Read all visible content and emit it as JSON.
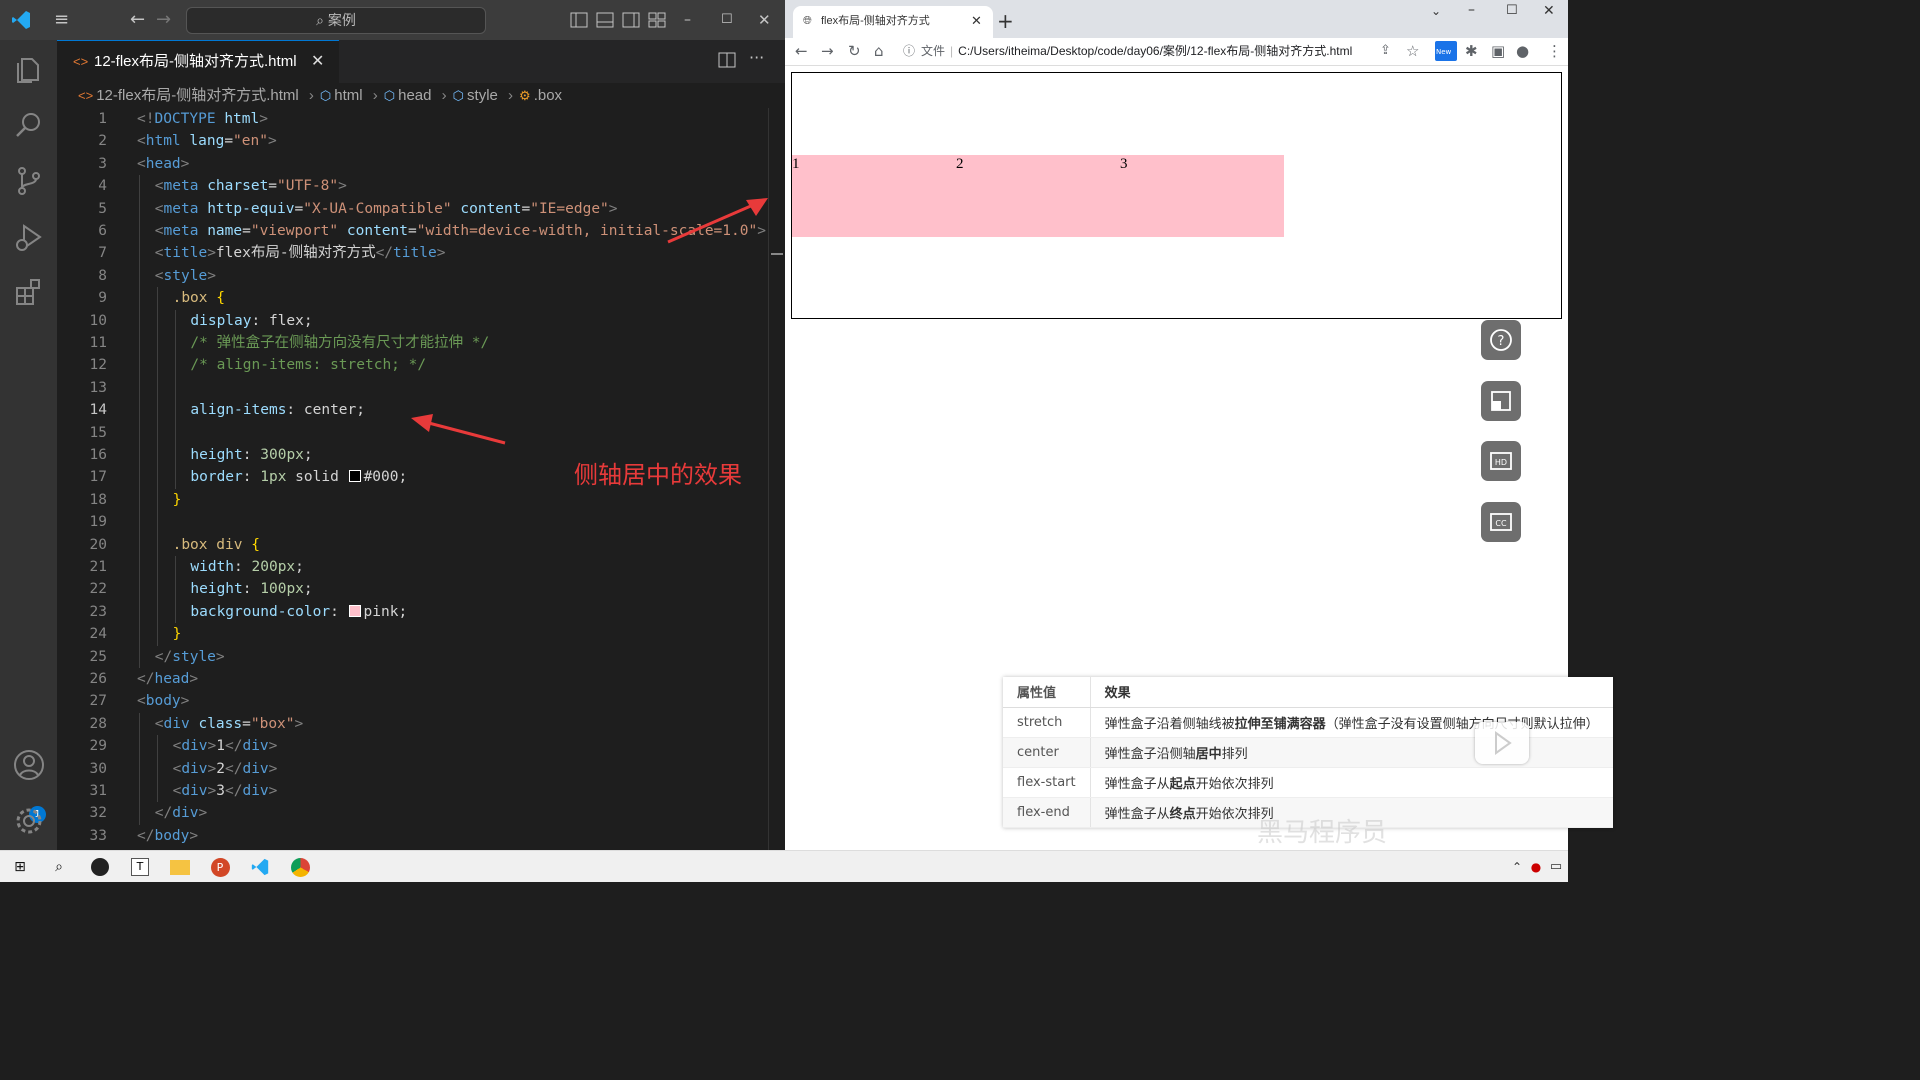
{
  "vscode": {
    "search_placeholder": "案例",
    "tab": {
      "label": "12-flex布局-侧轴对齐方式.html",
      "icon": "html-file-icon"
    },
    "breadcrumb": [
      "12-flex布局-侧轴对齐方式.html",
      "html",
      "head",
      "style",
      ".box"
    ],
    "active_line": 14,
    "account_badge": "1",
    "annotation": "侧轴居中的效果"
  },
  "code": [
    {
      "n": "1",
      "indent": 0,
      "parts": [
        [
          "t-br",
          "<!"
        ],
        [
          "t-tag",
          "DOCTYPE"
        ],
        [
          "t-txt",
          " "
        ],
        [
          "t-attr",
          "html"
        ],
        [
          "t-br",
          ">"
        ]
      ]
    },
    {
      "n": "2",
      "indent": 0,
      "parts": [
        [
          "t-br",
          "<"
        ],
        [
          "t-tag",
          "html"
        ],
        [
          "t-txt",
          " "
        ],
        [
          "t-attr",
          "lang"
        ],
        [
          "t-txt",
          "="
        ],
        [
          "t-str",
          "\"en\""
        ],
        [
          "t-br",
          ">"
        ]
      ]
    },
    {
      "n": "3",
      "indent": 0,
      "parts": [
        [
          "t-br",
          "<"
        ],
        [
          "t-tag",
          "head"
        ],
        [
          "t-br",
          ">"
        ]
      ]
    },
    {
      "n": "4",
      "indent": 1,
      "parts": [
        [
          "t-br",
          "<"
        ],
        [
          "t-tag",
          "meta"
        ],
        [
          "t-txt",
          " "
        ],
        [
          "t-attr",
          "charset"
        ],
        [
          "t-txt",
          "="
        ],
        [
          "t-str",
          "\"UTF-8\""
        ],
        [
          "t-br",
          ">"
        ]
      ]
    },
    {
      "n": "5",
      "indent": 1,
      "parts": [
        [
          "t-br",
          "<"
        ],
        [
          "t-tag",
          "meta"
        ],
        [
          "t-txt",
          " "
        ],
        [
          "t-attr",
          "http-equiv"
        ],
        [
          "t-txt",
          "="
        ],
        [
          "t-str",
          "\"X-UA-Compatible\""
        ],
        [
          "t-txt",
          " "
        ],
        [
          "t-attr",
          "content"
        ],
        [
          "t-txt",
          "="
        ],
        [
          "t-str",
          "\"IE=edge\""
        ],
        [
          "t-br",
          ">"
        ]
      ]
    },
    {
      "n": "6",
      "indent": 1,
      "parts": [
        [
          "t-br",
          "<"
        ],
        [
          "t-tag",
          "meta"
        ],
        [
          "t-txt",
          " "
        ],
        [
          "t-attr",
          "name"
        ],
        [
          "t-txt",
          "="
        ],
        [
          "t-str",
          "\"viewport\""
        ],
        [
          "t-txt",
          " "
        ],
        [
          "t-attr",
          "content"
        ],
        [
          "t-txt",
          "="
        ],
        [
          "t-str",
          "\"width=device-width, initial-scale=1.0\""
        ],
        [
          "t-br",
          ">"
        ]
      ]
    },
    {
      "n": "7",
      "indent": 1,
      "parts": [
        [
          "t-br",
          "<"
        ],
        [
          "t-tag",
          "title"
        ],
        [
          "t-br",
          ">"
        ],
        [
          "t-txt",
          "flex布局-侧轴对齐方式"
        ],
        [
          "t-br",
          "</"
        ],
        [
          "t-tag",
          "title"
        ],
        [
          "t-br",
          ">"
        ]
      ]
    },
    {
      "n": "8",
      "indent": 1,
      "parts": [
        [
          "t-br",
          "<"
        ],
        [
          "t-tag",
          "style"
        ],
        [
          "t-br",
          ">"
        ]
      ]
    },
    {
      "n": "9",
      "indent": 2,
      "parts": [
        [
          "t-sel",
          ".box"
        ],
        [
          "t-txt",
          " "
        ],
        [
          "t-brace",
          "{"
        ]
      ]
    },
    {
      "n": "10",
      "indent": 3,
      "parts": [
        [
          "t-prop",
          "display"
        ],
        [
          "t-txt",
          ": "
        ],
        [
          "t-txt",
          "flex"
        ],
        [
          "t-txt",
          ";"
        ]
      ]
    },
    {
      "n": "11",
      "indent": 3,
      "parts": [
        [
          "t-cm",
          "/* 弹性盒子在侧轴方向没有尺寸才能拉伸 */"
        ]
      ]
    },
    {
      "n": "12",
      "indent": 3,
      "parts": [
        [
          "t-cm",
          "/* align-items: stretch; */"
        ]
      ]
    },
    {
      "n": "13",
      "indent": 3,
      "parts": []
    },
    {
      "n": "14",
      "indent": 3,
      "parts": [
        [
          "t-prop",
          "align-items"
        ],
        [
          "t-txt",
          ": "
        ],
        [
          "t-txt",
          "center"
        ],
        [
          "t-txt",
          ";"
        ]
      ]
    },
    {
      "n": "15",
      "indent": 3,
      "parts": []
    },
    {
      "n": "16",
      "indent": 3,
      "parts": [
        [
          "t-prop",
          "height"
        ],
        [
          "t-txt",
          ": "
        ],
        [
          "t-num",
          "300px"
        ],
        [
          "t-txt",
          ";"
        ]
      ]
    },
    {
      "n": "17",
      "indent": 3,
      "parts": [
        [
          "t-prop",
          "border"
        ],
        [
          "t-txt",
          ": "
        ],
        [
          "t-num",
          "1px"
        ],
        [
          "t-txt",
          " solid "
        ],
        [
          "swatch",
          "#000"
        ],
        [
          "t-txt",
          "#000;"
        ]
      ]
    },
    {
      "n": "18",
      "indent": 2,
      "parts": [
        [
          "t-brace",
          "}"
        ]
      ]
    },
    {
      "n": "19",
      "indent": 2,
      "parts": []
    },
    {
      "n": "20",
      "indent": 2,
      "parts": [
        [
          "t-sel",
          ".box"
        ],
        [
          "t-txt",
          " "
        ],
        [
          "t-sel",
          "div"
        ],
        [
          "t-txt",
          " "
        ],
        [
          "t-brace",
          "{"
        ]
      ]
    },
    {
      "n": "21",
      "indent": 3,
      "parts": [
        [
          "t-prop",
          "width"
        ],
        [
          "t-txt",
          ": "
        ],
        [
          "t-num",
          "200px"
        ],
        [
          "t-txt",
          ";"
        ]
      ]
    },
    {
      "n": "22",
      "indent": 3,
      "parts": [
        [
          "t-prop",
          "height"
        ],
        [
          "t-txt",
          ": "
        ],
        [
          "t-num",
          "100px"
        ],
        [
          "t-txt",
          ";"
        ]
      ]
    },
    {
      "n": "23",
      "indent": 3,
      "parts": [
        [
          "t-prop",
          "background-color"
        ],
        [
          "t-txt",
          ": "
        ],
        [
          "swatch",
          "pink"
        ],
        [
          "t-txt",
          "pink;"
        ]
      ]
    },
    {
      "n": "24",
      "indent": 2,
      "parts": [
        [
          "t-brace",
          "}"
        ]
      ]
    },
    {
      "n": "25",
      "indent": 1,
      "parts": [
        [
          "t-br",
          "</"
        ],
        [
          "t-tag",
          "style"
        ],
        [
          "t-br",
          ">"
        ]
      ]
    },
    {
      "n": "26",
      "indent": 0,
      "parts": [
        [
          "t-br",
          "</"
        ],
        [
          "t-tag",
          "head"
        ],
        [
          "t-br",
          ">"
        ]
      ]
    },
    {
      "n": "27",
      "indent": 0,
      "parts": [
        [
          "t-br",
          "<"
        ],
        [
          "t-tag",
          "body"
        ],
        [
          "t-br",
          ">"
        ]
      ]
    },
    {
      "n": "28",
      "indent": 1,
      "parts": [
        [
          "t-br",
          "<"
        ],
        [
          "t-tag",
          "div"
        ],
        [
          "t-txt",
          " "
        ],
        [
          "t-attr",
          "class"
        ],
        [
          "t-txt",
          "="
        ],
        [
          "t-str",
          "\"box\""
        ],
        [
          "t-br",
          ">"
        ]
      ]
    },
    {
      "n": "29",
      "indent": 2,
      "parts": [
        [
          "t-br",
          "<"
        ],
        [
          "t-tag",
          "div"
        ],
        [
          "t-br",
          ">"
        ],
        [
          "t-txt",
          "1"
        ],
        [
          "t-br",
          "</"
        ],
        [
          "t-tag",
          "div"
        ],
        [
          "t-br",
          ">"
        ]
      ]
    },
    {
      "n": "30",
      "indent": 2,
      "parts": [
        [
          "t-br",
          "<"
        ],
        [
          "t-tag",
          "div"
        ],
        [
          "t-br",
          ">"
        ],
        [
          "t-txt",
          "2"
        ],
        [
          "t-br",
          "</"
        ],
        [
          "t-tag",
          "div"
        ],
        [
          "t-br",
          ">"
        ]
      ]
    },
    {
      "n": "31",
      "indent": 2,
      "parts": [
        [
          "t-br",
          "<"
        ],
        [
          "t-tag",
          "div"
        ],
        [
          "t-br",
          ">"
        ],
        [
          "t-txt",
          "3"
        ],
        [
          "t-br",
          "</"
        ],
        [
          "t-tag",
          "div"
        ],
        [
          "t-br",
          ">"
        ]
      ]
    },
    {
      "n": "32",
      "indent": 1,
      "parts": [
        [
          "t-br",
          "</"
        ],
        [
          "t-tag",
          "div"
        ],
        [
          "t-br",
          ">"
        ]
      ]
    },
    {
      "n": "33",
      "indent": 0,
      "parts": [
        [
          "t-br",
          "</"
        ],
        [
          "t-tag",
          "body"
        ],
        [
          "t-br",
          ">"
        ]
      ]
    }
  ],
  "browser": {
    "tab_title": "flex布局-侧轴对齐方式",
    "omnibox_scheme": "文件",
    "url": "C:/Users/itheima/Desktop/code/day06/案例/12-flex布局-侧轴对齐方式.html",
    "demo_items": [
      "1",
      "2",
      "3"
    ],
    "extension_badge": "New"
  },
  "reference_table": {
    "headers": [
      "属性值",
      "效果"
    ],
    "rows": [
      {
        "value": "stretch",
        "pre": "弹性盒子沿着侧轴线被",
        "bold": "拉伸至铺满容器",
        "post": "（弹性盒子没有设置侧轴方向尺寸则默认拉伸）"
      },
      {
        "value": "center",
        "pre": "弹性盒子沿侧轴",
        "bold": "居中",
        "post": "排列"
      },
      {
        "value": "flex-start",
        "pre": "弹性盒子从",
        "bold": "起点",
        "post": "开始依次排列"
      },
      {
        "value": "flex-end",
        "pre": "弹性盒子从",
        "bold": "终点",
        "post": "开始依次排列"
      }
    ]
  },
  "watermark": "黑马程序员",
  "colors": {
    "annotation": "#e83a3a",
    "accent": "#0078d4",
    "demo_item": "pink"
  }
}
